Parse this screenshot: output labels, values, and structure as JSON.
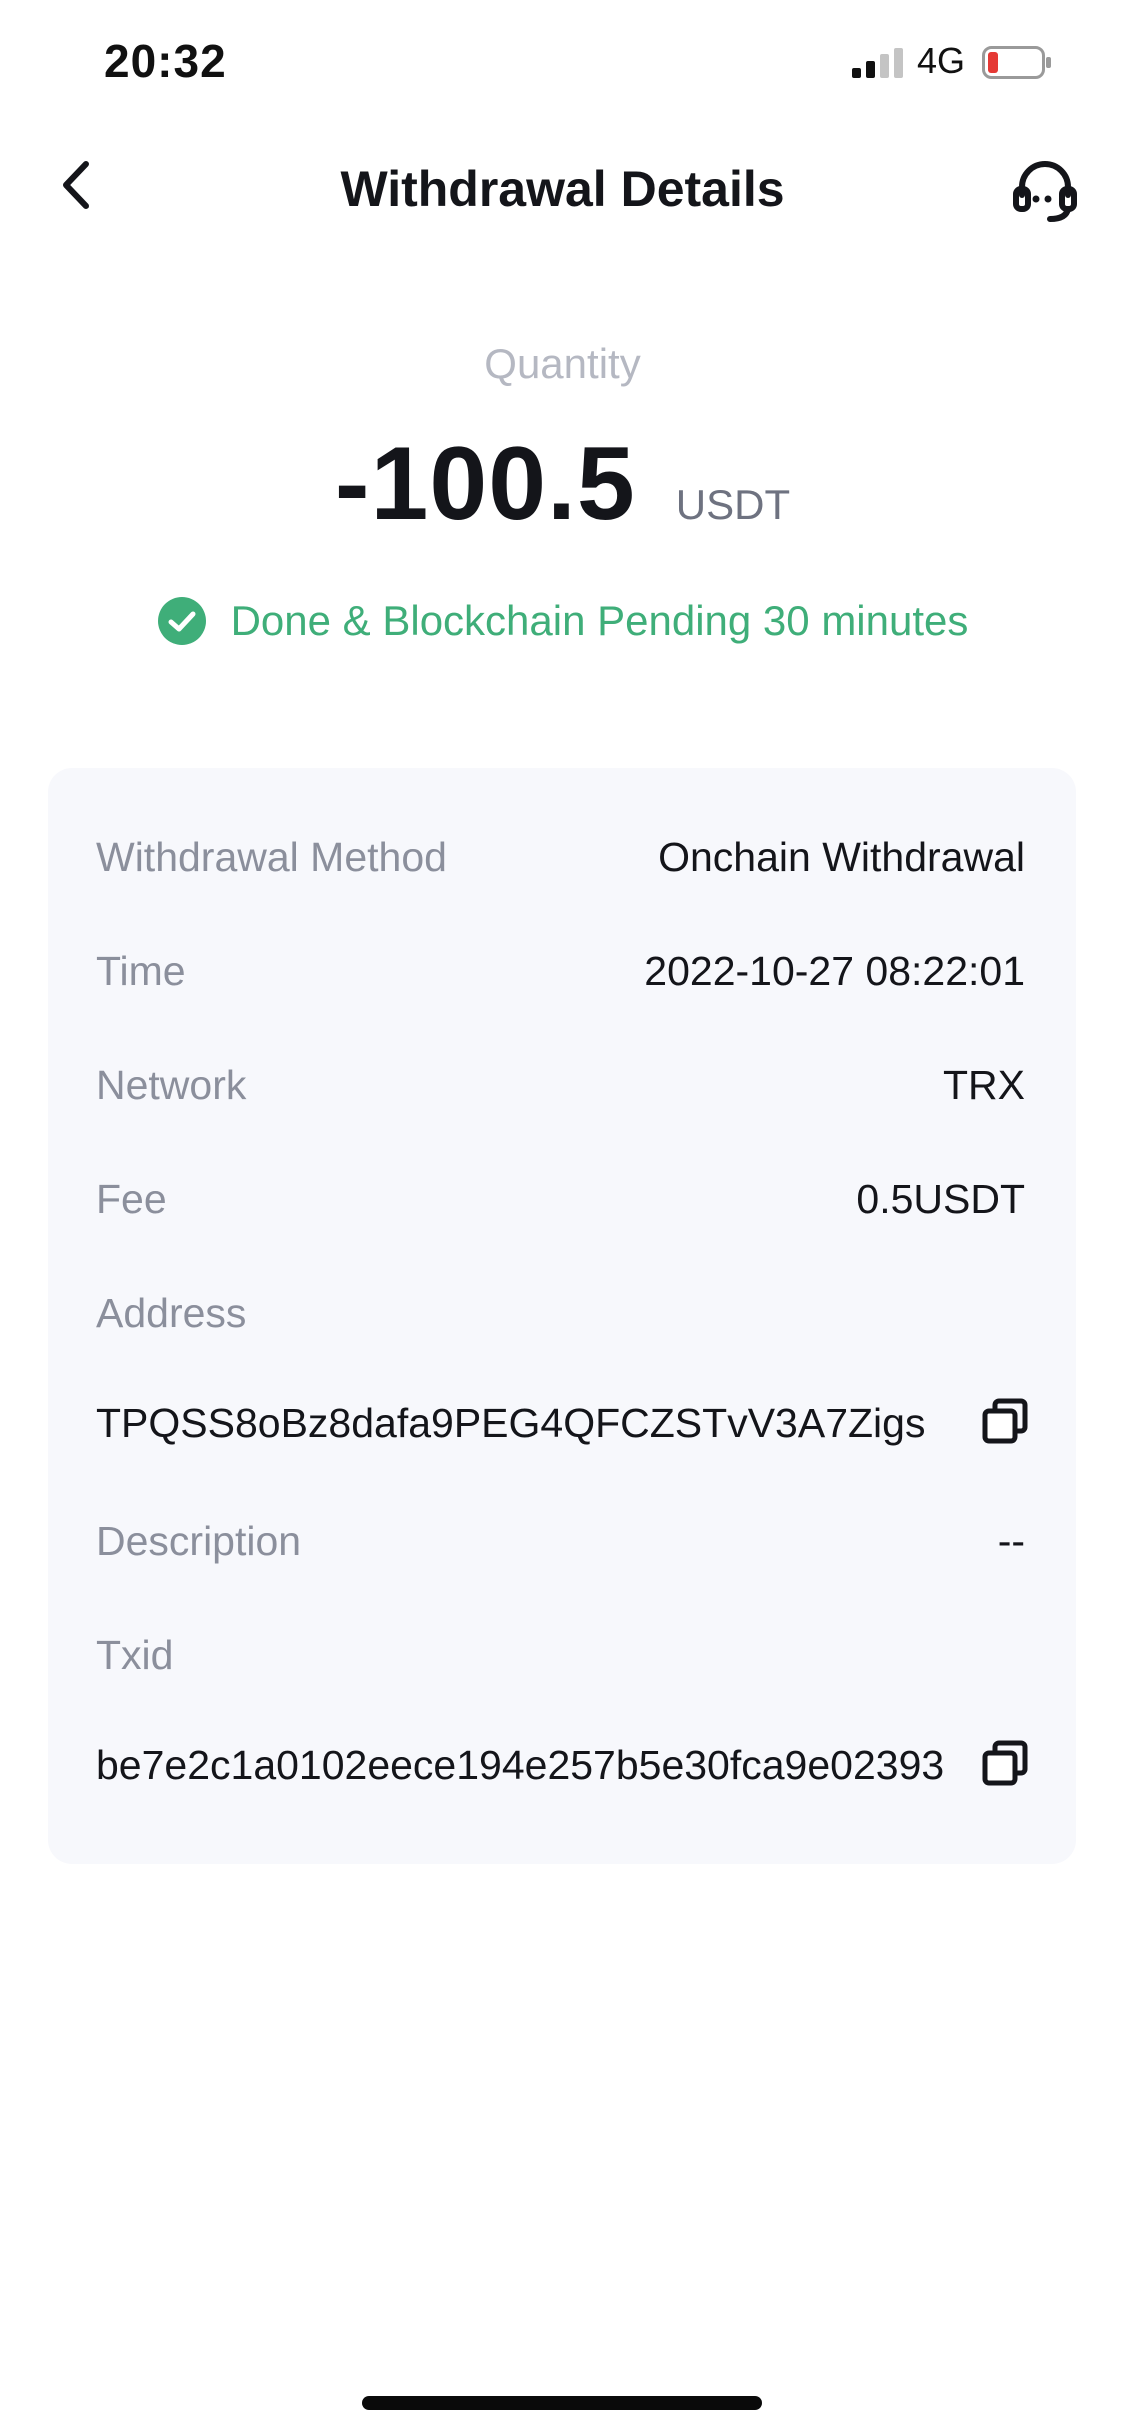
{
  "status_bar": {
    "time": "20:32",
    "network": "4G",
    "battery_color": "#e53935"
  },
  "header": {
    "title": "Withdrawal Details",
    "back_icon": "chevron-left-icon",
    "support_icon": "headset-icon"
  },
  "summary": {
    "quantity_label": "Quantity",
    "amount": "-100.5",
    "currency": "USDT",
    "status_text": "Done & Blockchain Pending 30 minutes",
    "status_color": "#3fae79"
  },
  "details": {
    "method_label": "Withdrawal Method",
    "method_value": "Onchain Withdrawal",
    "time_label": "Time",
    "time_value": "2022-10-27 08:22:01",
    "network_label": "Network",
    "network_value": "TRX",
    "fee_label": "Fee",
    "fee_value": "0.5USDT",
    "address_label": "Address",
    "address_value": "TPQSS8oBz8dafa9PEG4QFCZSTvV3A7Zigs",
    "description_label": "Description",
    "description_value": "--",
    "txid_label": "Txid",
    "txid_value": "be7e2c1a0102eece194e257b5e30fca9e02393"
  }
}
